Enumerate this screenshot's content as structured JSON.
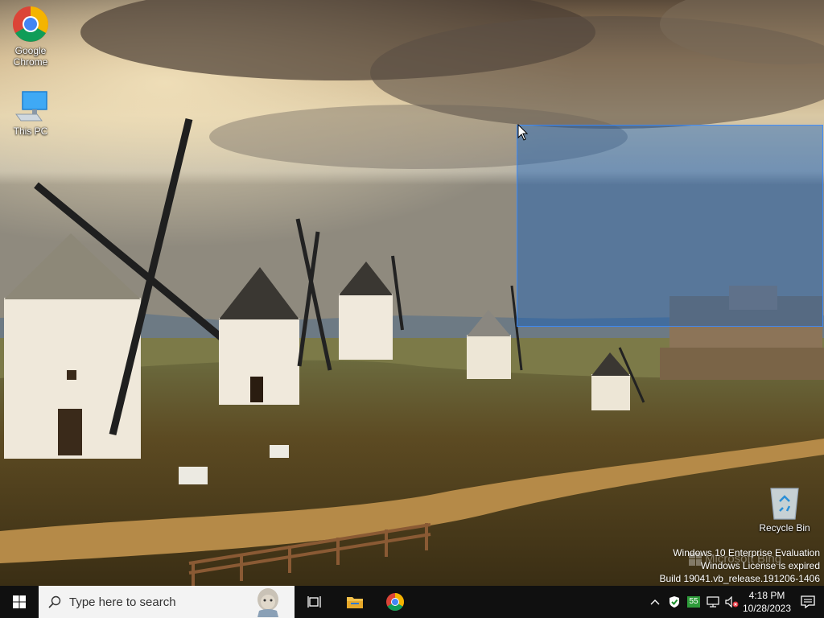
{
  "desktop": {
    "icons": [
      {
        "label_line1": "Google",
        "label_line2": "Chrome",
        "icon": "chrome-icon"
      },
      {
        "label": "This PC",
        "icon": "monitor-icon"
      },
      {
        "label": "Recycle Bin",
        "icon": "recycle-bin-icon"
      }
    ],
    "watermark": {
      "line1": "Windows 10 Enterprise Evaluation",
      "line2": "Windows License is expired",
      "line3": "Build 19041.vb_release.191206-1406"
    },
    "bing_label": "Microsoft Bing"
  },
  "taskbar": {
    "start_icon": "windows-logo-icon",
    "search_placeholder": "Type here to search",
    "apps": [
      "task-view-icon",
      "file-explorer-icon",
      "chrome-icon"
    ],
    "tray": {
      "badge_count": "55",
      "time": "4:18 PM",
      "date": "10/28/2023",
      "icons": [
        "chevron-up-icon",
        "security-shield-icon",
        "badge-icon",
        "network-icon",
        "volume-muted-icon",
        "notification-icon"
      ]
    }
  },
  "colors": {
    "selection": "#1e64c8",
    "taskbar": "#101010",
    "search_bg": "#f3f3f3"
  }
}
